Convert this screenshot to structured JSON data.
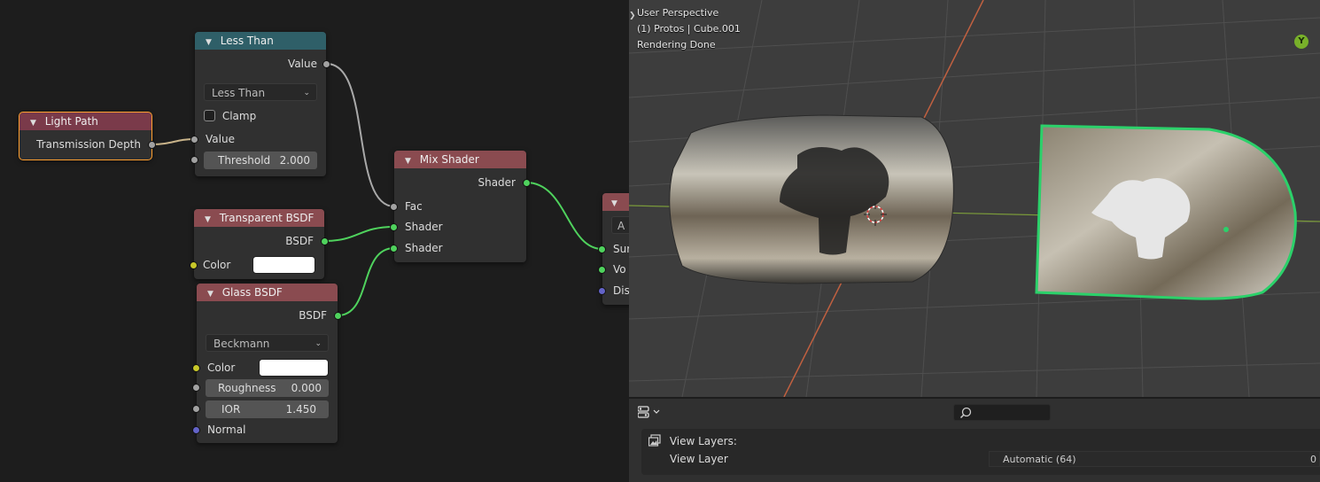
{
  "node_editor": {
    "nodes": {
      "less_than": {
        "title": "Less Than",
        "output_value": "Value",
        "operation": "Less Than",
        "clamp_label": "Clamp",
        "input_value": "Value",
        "threshold_label": "Threshold",
        "threshold_value": "2.000"
      },
      "light_path": {
        "title": "Light Path",
        "output_transmission_depth": "Transmission Depth"
      },
      "transparent_bsdf": {
        "title": "Transparent BSDF",
        "output_bsdf": "BSDF",
        "color_label": "Color",
        "color": "#ffffff"
      },
      "glass_bsdf": {
        "title": "Glass BSDF",
        "output_bsdf": "BSDF",
        "distribution": "Beckmann",
        "color_label": "Color",
        "color": "#ffffff",
        "roughness_label": "Roughness",
        "roughness_value": "0.000",
        "ior_label": "IOR",
        "ior_value": "1.450",
        "normal_label": "Normal"
      },
      "mix_shader": {
        "title": "Mix Shader",
        "output_shader": "Shader",
        "fac_label": "Fac",
        "shader1_label": "Shader",
        "shader2_label": "Shader"
      },
      "material_output": {
        "dropdown": "A",
        "input_surface": "Sur",
        "input_volume": "Vo",
        "input_displacement": "Dis"
      }
    }
  },
  "viewport": {
    "view_name": "User Perspective",
    "object_info": "(1) Protos | Cube.001",
    "render_status": "Rendering Done",
    "gizmo_axis": "Y"
  },
  "outliner": {
    "view_layers_label": "View Layers:",
    "view_layer_label": "View Layer",
    "samples_value": "Automatic (64)",
    "trailing_value": "0"
  }
}
